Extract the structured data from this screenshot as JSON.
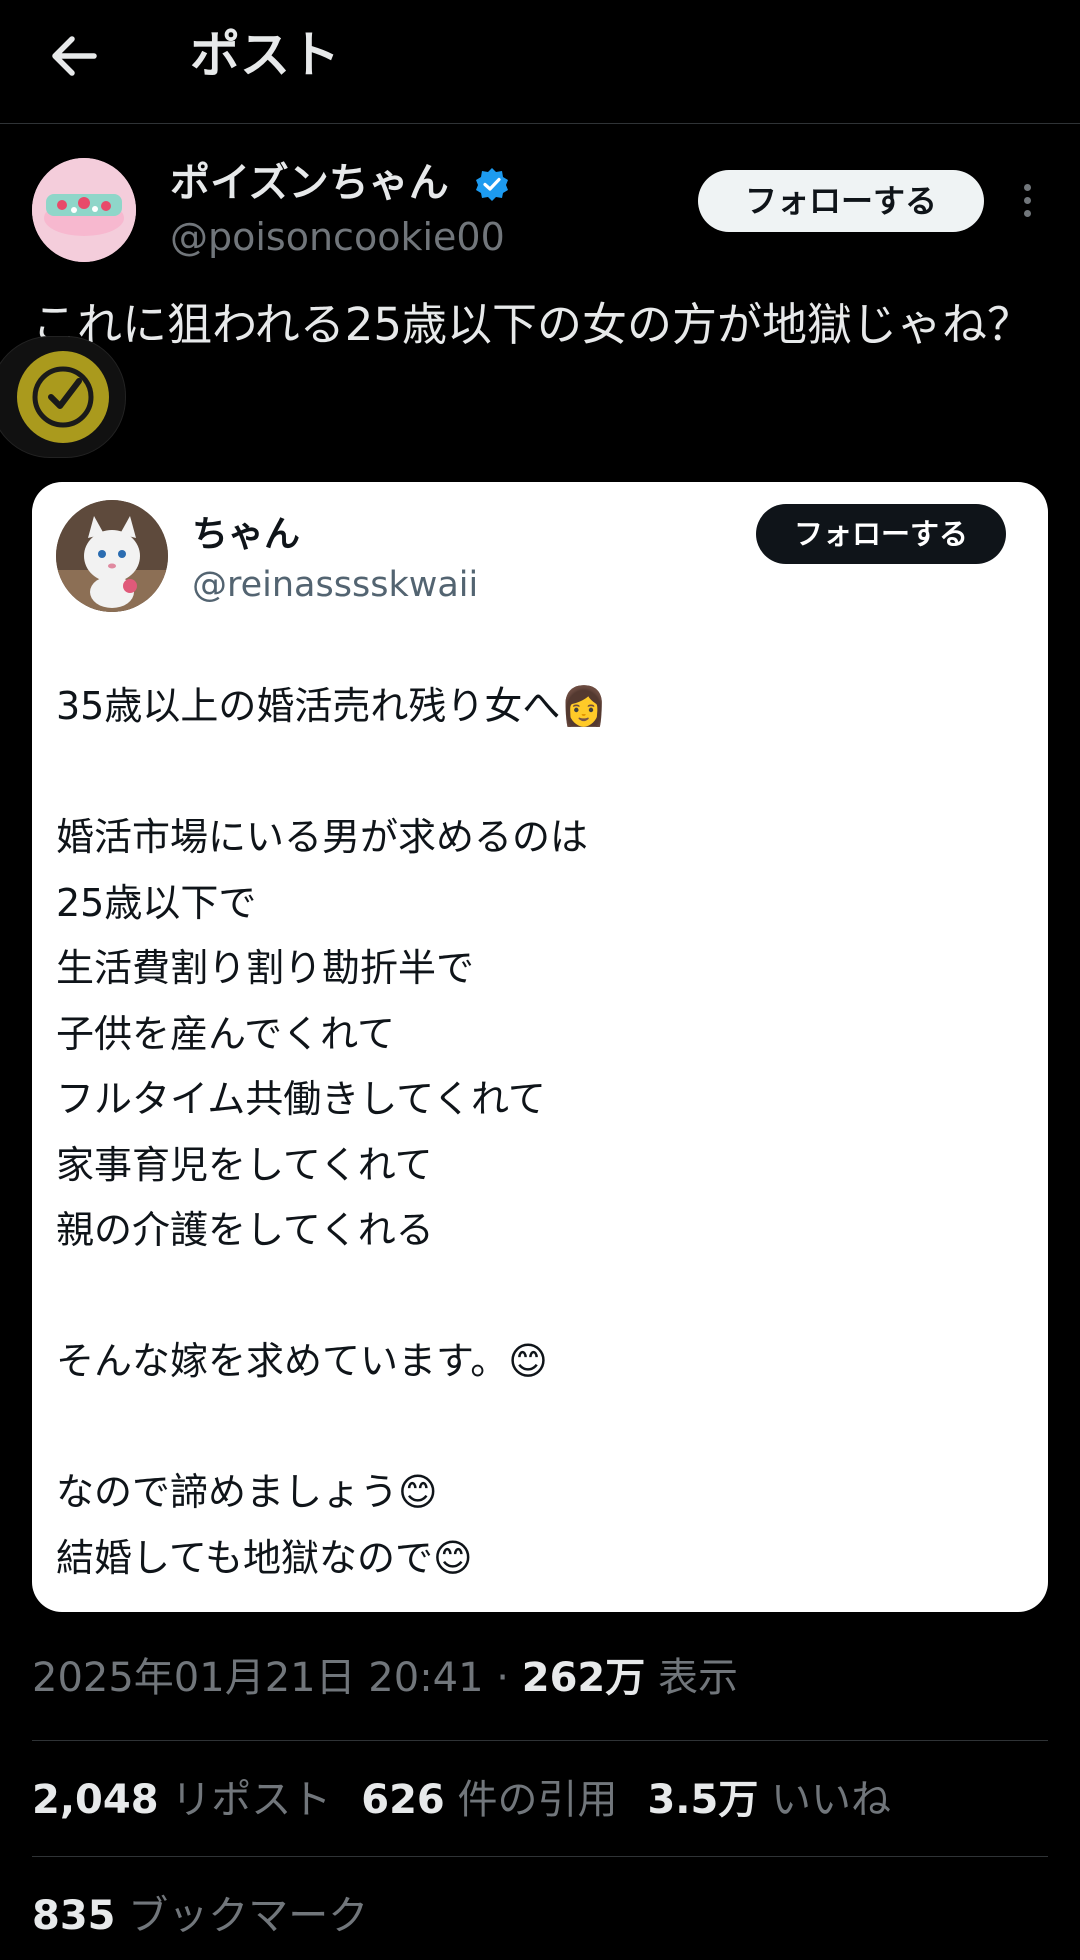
{
  "header": {
    "title": "ポスト",
    "back_icon": "arrow-left-icon"
  },
  "author": {
    "name": "ポイズンちゃん",
    "handle": "@poisoncookie00",
    "verified": true,
    "verified_color": "#1d9bf0",
    "follow_label": "フォローする"
  },
  "post": {
    "text": "これに狙われる25歳以下の女の方が地獄じゃね？"
  },
  "quoted": {
    "name": "ちゃん",
    "handle": "@reinasssskwaii",
    "follow_label": "フォローする",
    "body": "35歳以上の婚活売れ残り女へ👩\n\n婚活市場にいる男が求めるのは\n25歳以下で\n生活費割り割り勘折半で\n子供を産んでくれて\nフルタイム共働きしてくれて\n家事育児をしてくれて\n親の介護をしてくれる\n\nそんな嫁を求めています。😊\n\nなので諦めましょう😊\n結婚しても地獄なので😊"
  },
  "meta": {
    "timestamp": "2025年01月21日 20:41",
    "separator": " · ",
    "views_count": "262万",
    "views_label": " 表示"
  },
  "stats": {
    "reposts_count": "2,048",
    "reposts_label": " リポスト",
    "quotes_count": "626",
    "quotes_label": " 件の引用",
    "likes_count": "3.5万",
    "likes_label": " いいね",
    "bookmarks_count": "835",
    "bookmarks_label": " ブックマーク"
  },
  "colors": {
    "background": "#000000",
    "text_primary": "#e7e9ea",
    "text_secondary": "#71767b",
    "divider": "#2f3336",
    "floating_badge": "#b7a61f"
  }
}
